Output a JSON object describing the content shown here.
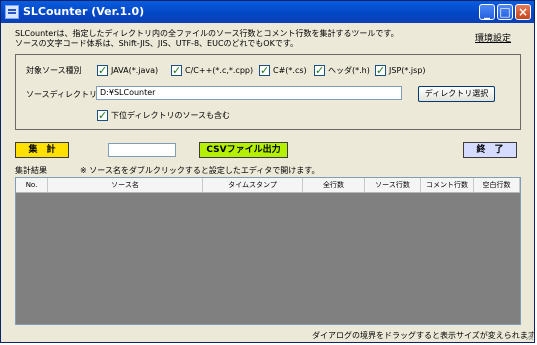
{
  "window": {
    "title": "SLCounter (Ver.1.0)",
    "controls": {
      "minimize": "_",
      "maximize": "□",
      "close": "×"
    }
  },
  "intro": {
    "line1": "SLCounterは、指定したディレクトリ内の全ファイルのソース行数とコメント行数を集計するツールです。",
    "line2": "ソースの文字コード体系は、Shift-JIS、JIS、UTF-8、EUCのどれでもOKです。",
    "settings_link": "環境設定"
  },
  "filters": {
    "source_type_label": "対象ソース種別",
    "types": [
      {
        "label": "JAVA(*.java)",
        "checked": true
      },
      {
        "label": "C/C++(*.c,*.cpp)",
        "checked": true
      },
      {
        "label": "C#(*.cs)",
        "checked": true
      },
      {
        "label": "ヘッダ(*.h)",
        "checked": true
      },
      {
        "label": "JSP(*.jsp)",
        "checked": true
      }
    ],
    "directory_label": "ソースディレクトリ",
    "directory_value": "D:¥SLCounter",
    "directory_button": "ディレクトリ選択",
    "subdir_label": "下位ディレクトリのソースも含む",
    "subdir_checked": true
  },
  "actions": {
    "count_button": "集　計",
    "progress_value": "",
    "csv_button": "CSVファイル出力",
    "exit_button": "終　了"
  },
  "results": {
    "label": "集計結果",
    "note": "※ ソース名をダブルクリックすると設定したエディタで開けます。",
    "columns": [
      "No.",
      "ソース名",
      "タイムスタンプ",
      "全行数",
      "ソース行数",
      "コメント行数",
      "空白行数"
    ],
    "rows": []
  },
  "footer": {
    "hint": "ダイアログの境界をドラッグすると表示サイズが変えられます。"
  },
  "colors": {
    "titlebar": "#0347c6",
    "count_button": "#ffe000",
    "csv_button": "#b4f000",
    "exit_button": "#d6dcff",
    "list_bg": "#808080"
  }
}
